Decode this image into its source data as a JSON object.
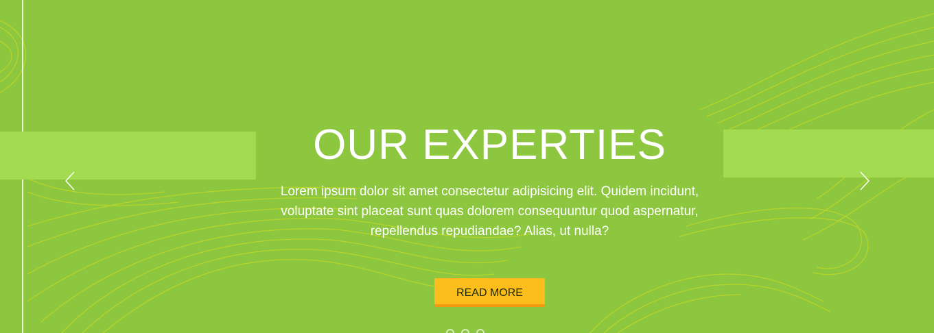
{
  "hero": {
    "title": "OUR EXPERTIES",
    "description_lines": [
      "Lorem ipsum dolor sit amet consectetur adipisicing elit. Quidem incidunt,",
      "voluptate sint placeat sunt quas dolorem consequuntur quod aspernatur,",
      "repellendus repudiandae? Alias, ut nulla?"
    ],
    "button_label": "READ MORE",
    "slide_count": 3,
    "active_slide": 2
  },
  "colors": {
    "background": "#8dc63f",
    "band": "#a2da50",
    "wave_lines": "#d8e21a",
    "button": "#fbbd1b",
    "button_border": "#f39a12",
    "text": "#ffffff"
  },
  "icons": {
    "prev": "chevron-left-icon",
    "next": "chevron-right-icon"
  }
}
